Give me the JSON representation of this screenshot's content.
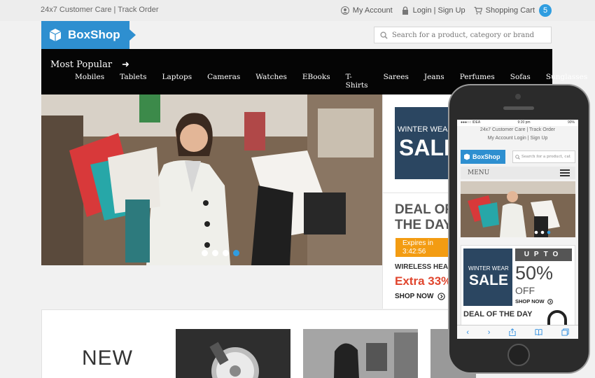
{
  "topbar": {
    "customer_care": "24x7 Customer Care | Track Order",
    "my_account": "My Account",
    "login_signup": "Login | Sign Up",
    "shopping_cart": "Shopping Cart",
    "cart_count": "5"
  },
  "header": {
    "logo_text": "BoxShop",
    "search_placeholder": "Search for a product, category or brand"
  },
  "nav": {
    "most_popular": "Most Popular",
    "arrow": "➜",
    "categories": [
      "Mobiles",
      "Tablets",
      "Laptops",
      "Cameras",
      "Watches",
      "EBooks",
      "T-Shirts",
      "Sarees",
      "Jeans",
      "Perfumes",
      "Sofas",
      "Sunglasses"
    ]
  },
  "promo": {
    "winter_line1": "WINTER WEAR",
    "winter_line2": "SALE",
    "deal_title": "DEAL OF THE DAY",
    "expires_label": "Expires in",
    "expires_time": "3:42:56",
    "product": "WIRELESS HEADPHONES",
    "discount": "Extra 33% Off",
    "shop_now": "SHOP NOW"
  },
  "bottom": {
    "new_label": "NEW"
  },
  "mobile": {
    "carrier": "●●●○○ IDEA",
    "time": "9:20 pm",
    "battery": "90%",
    "customer_care": "24x7 Customer Care | Track Order",
    "account_row": "My Account   Login | Sign Up",
    "logo_text": "BoxShop",
    "search_placeholder": "Search for a product, cat",
    "menu": "MENU",
    "winter_line1": "WINTER WEAR",
    "winter_line2": "SALE",
    "upto": "UPTO",
    "percent": "50%",
    "off": "OFF",
    "shop_now": "SHOP NOW",
    "deal_title": "DEAL OF THE DAY"
  },
  "colors": {
    "brand_blue": "#2e8fd0",
    "navy": "#2b4661",
    "orange": "#f39c12",
    "red": "#e0452d"
  }
}
